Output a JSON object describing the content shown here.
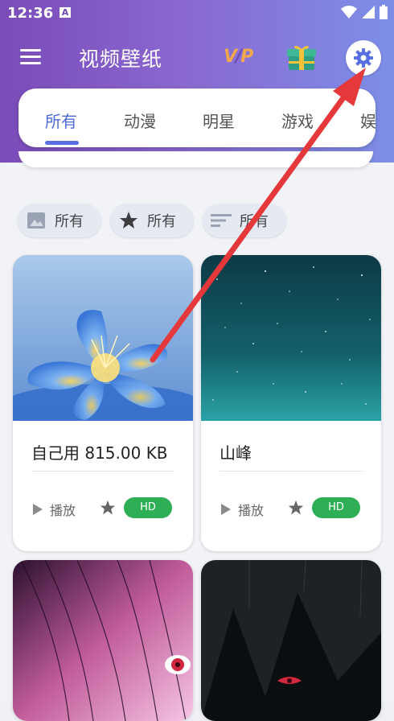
{
  "status_bar": {
    "time": "12:36",
    "notification_letter": "A"
  },
  "app": {
    "title": "视频壁纸"
  },
  "tabs": [
    {
      "label": "所有",
      "active": true
    },
    {
      "label": "动漫",
      "active": false
    },
    {
      "label": "明星",
      "active": false
    },
    {
      "label": "游戏",
      "active": false
    },
    {
      "label": "娱",
      "active": false
    }
  ],
  "filters": [
    {
      "label": "所有",
      "icon": "image-icon"
    },
    {
      "label": "所有",
      "icon": "star-icon"
    },
    {
      "label": "所有",
      "icon": "sort-icon"
    }
  ],
  "wallpapers": [
    {
      "name": "自己用 815.00 KB",
      "play_label": "播放",
      "badge": "HD"
    },
    {
      "name": "山峰",
      "play_label": "播放",
      "badge": "HD"
    }
  ],
  "colors": {
    "accent": "#5a6fe0",
    "hd_badge": "#2eae55",
    "arrow": "#e5383b"
  }
}
